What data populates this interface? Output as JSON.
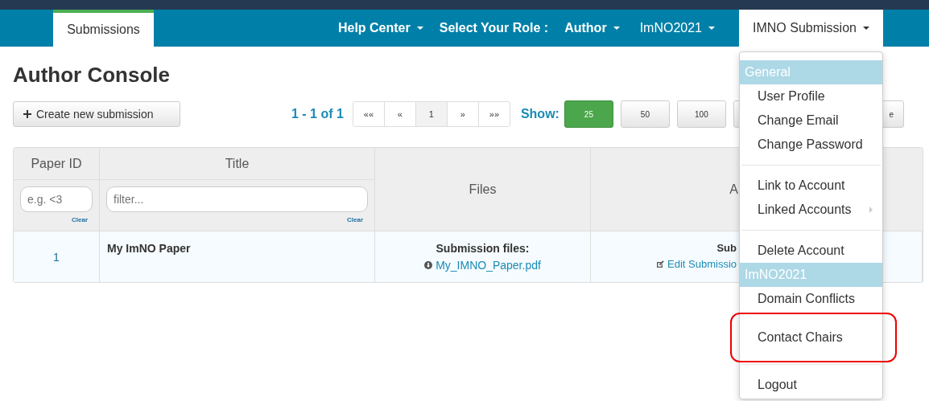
{
  "navbar": {
    "tabs": [
      {
        "label": "Submissions",
        "selected": true
      }
    ],
    "items": [
      {
        "label": "Help Center",
        "kind": "menu",
        "bold": true,
        "selected": false
      },
      {
        "label": "Select Your Role :",
        "kind": "label",
        "bold": true,
        "selected": false
      },
      {
        "label": "Author",
        "kind": "menu",
        "bold": true,
        "selected": false
      },
      {
        "label": "ImNO2021",
        "kind": "menu",
        "bold": false,
        "selected": false
      },
      {
        "label": "IMNO Submission",
        "kind": "menu",
        "bold": false,
        "selected": true
      }
    ]
  },
  "page_title": "Author Console",
  "create_button": "Create new submission",
  "pagination": {
    "range": "1 - 1 of 1",
    "pages": [
      {
        "label": "««",
        "selected": false
      },
      {
        "label": "«",
        "selected": false
      },
      {
        "label": "1",
        "selected": true
      },
      {
        "label": "»",
        "selected": false
      },
      {
        "label": "»»",
        "selected": false
      }
    ],
    "show_label": "Show:",
    "show_options": [
      {
        "label": "25",
        "selected": true
      },
      {
        "label": "50",
        "selected": false
      },
      {
        "label": "100",
        "selected": false
      },
      {
        "selected": false
      },
      {
        "label": "e",
        "selected": false
      }
    ]
  },
  "table": {
    "columns": [
      {
        "label": "Paper ID",
        "filter_placeholder": "e.g. <3",
        "clear": "Clear"
      },
      {
        "label": "Title",
        "filter_placeholder": "filter...",
        "clear": "Clear"
      },
      {
        "label": "Files"
      },
      {
        "label": "A"
      }
    ],
    "rows": [
      {
        "paper_id": "1",
        "title": "My ImNO Paper",
        "files_label": "Submission files:",
        "file": "My_IMNO_Paper.pdf",
        "column_4_label": "Sub",
        "column_4_link": "Edit Submissio"
      }
    ]
  },
  "dropdown": [
    {
      "kind": "header",
      "label": "General"
    },
    {
      "kind": "item",
      "label": "User Profile",
      "highlighted": false
    },
    {
      "kind": "item",
      "label": "Change Email",
      "highlighted": false
    },
    {
      "kind": "item",
      "label": "Change Password",
      "highlighted": false
    },
    {
      "kind": "divider"
    },
    {
      "kind": "item",
      "label": "Link to Account",
      "highlighted": false
    },
    {
      "kind": "submenu",
      "label": "Linked Accounts",
      "highlighted": false
    },
    {
      "kind": "divider"
    },
    {
      "kind": "item",
      "label": "Delete Account",
      "highlighted": false
    },
    {
      "kind": "header",
      "label": "ImNO2021"
    },
    {
      "kind": "item",
      "label": "Domain Conflicts",
      "highlighted": false
    },
    {
      "kind": "item",
      "label": "Contact Chairs",
      "highlighted": true
    },
    {
      "kind": "divider"
    },
    {
      "kind": "item",
      "label": "Logout",
      "highlighted": false
    }
  ]
}
